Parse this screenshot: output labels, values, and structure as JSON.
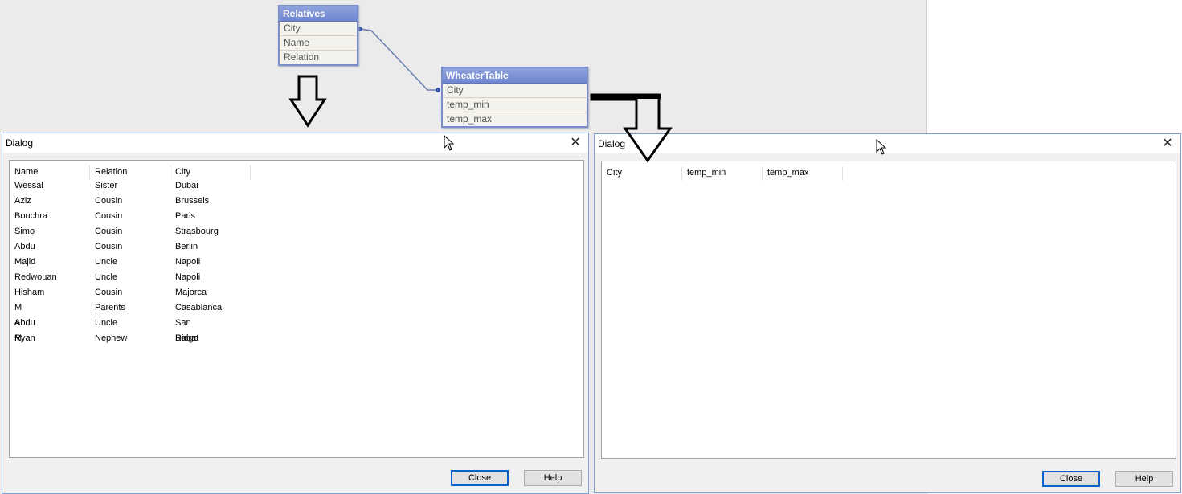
{
  "relatives_table": {
    "title": "Relatives",
    "fields": [
      "City",
      "Name",
      "Relation"
    ]
  },
  "weather_table": {
    "title": "WheaterTable",
    "fields": [
      "City",
      "temp_min",
      "temp_max"
    ]
  },
  "dialog_left": {
    "title": "Dialog",
    "columns": [
      "Name",
      "Relation",
      "City"
    ],
    "rows": [
      [
        "Wessal",
        "Sister",
        "Dubai"
      ],
      [
        "Aziz",
        "Cousin",
        "Brussels"
      ],
      [
        "Bouchra",
        "Cousin",
        "Paris"
      ],
      [
        "Simo",
        "Cousin",
        "Strasbourg"
      ],
      [
        "Abdu",
        "Cousin",
        "Berlin"
      ],
      [
        "Majid",
        "Uncle",
        "Napoli"
      ],
      [
        "Redwouan",
        "Uncle",
        "Napoli"
      ],
      [
        "Hisham",
        "Cousin",
        "Majorca"
      ],
      [
        "M & M",
        "Parents",
        "Casablanca"
      ],
      [
        "Abdu",
        "Uncle",
        "San Diego"
      ],
      [
        "Ryan",
        "Nephew",
        "Rabat"
      ]
    ],
    "close_label": "Close",
    "help_label": "Help"
  },
  "dialog_right": {
    "title": "Dialog",
    "columns": [
      "City",
      "temp_min",
      "temp_max"
    ],
    "rows": [],
    "close_label": "Close",
    "help_label": "Help"
  },
  "icons": {
    "close": "close-x-icon",
    "arrow": "down-arrow-icon",
    "cursor": "mouse-cursor-icon"
  },
  "colors": {
    "table_header": "#7b91d6",
    "link_line": "#6b7fb3",
    "dialog_default_border": "#0b63c7"
  }
}
